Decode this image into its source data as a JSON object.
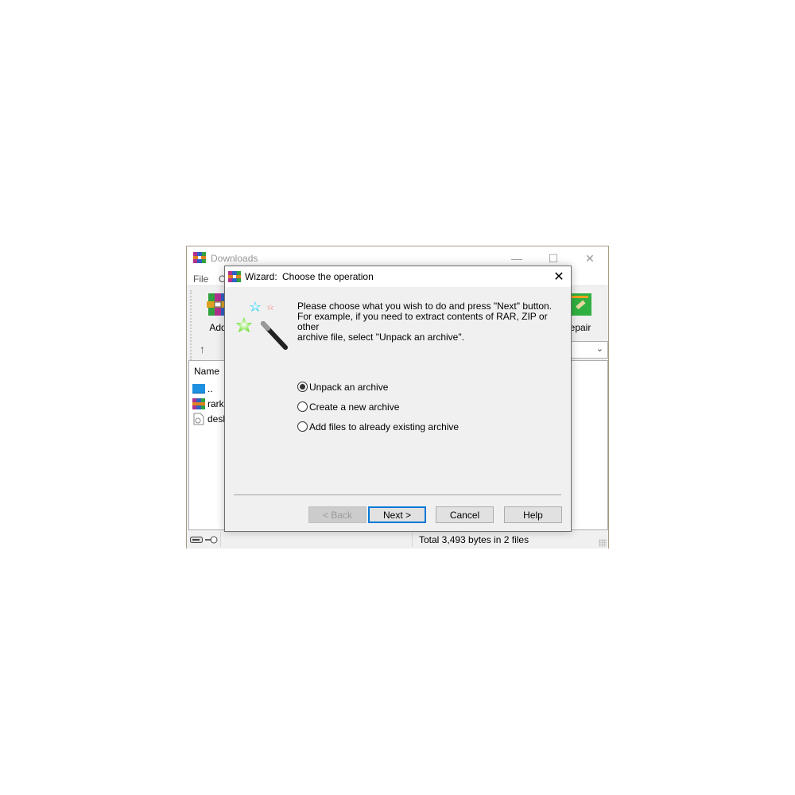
{
  "main_window": {
    "title": "Downloads",
    "menu": [
      "File",
      "C"
    ],
    "toolbar": {
      "left_tool_label": "Add",
      "right_tool_label": "epair"
    },
    "address_up_icon": "up-arrow-icon",
    "file_list": {
      "column_header": "Name",
      "rows": [
        {
          "name": "..",
          "icon": "folder-up-icon"
        },
        {
          "name": "rarke",
          "icon": "winrar-archive-icon"
        },
        {
          "name": "desk",
          "icon": "settings-file-icon"
        }
      ]
    },
    "status": {
      "text": "Total 3,493 bytes in 2 files"
    },
    "window_controls": {
      "minimize": "—",
      "maximize": "☐",
      "close": "✕"
    }
  },
  "wizard": {
    "label": "Wizard:",
    "heading": "Choose the operation",
    "close": "✕",
    "intro_lines": [
      "Please choose what you wish to do and press \"Next\" button.",
      "For example, if you need to extract contents of RAR, ZIP or other",
      "archive file, select \"Unpack an archive\"."
    ],
    "options": [
      {
        "label": "Unpack an archive",
        "selected": true
      },
      {
        "label": "Create a new archive",
        "selected": false
      },
      {
        "label": "Add files to already existing archive",
        "selected": false
      }
    ],
    "buttons": {
      "back": "< Back",
      "next": "Next >",
      "cancel": "Cancel",
      "help": "Help"
    }
  },
  "colors": {
    "accent": "#0078d7",
    "dialog_bg": "#f0f0f0"
  }
}
